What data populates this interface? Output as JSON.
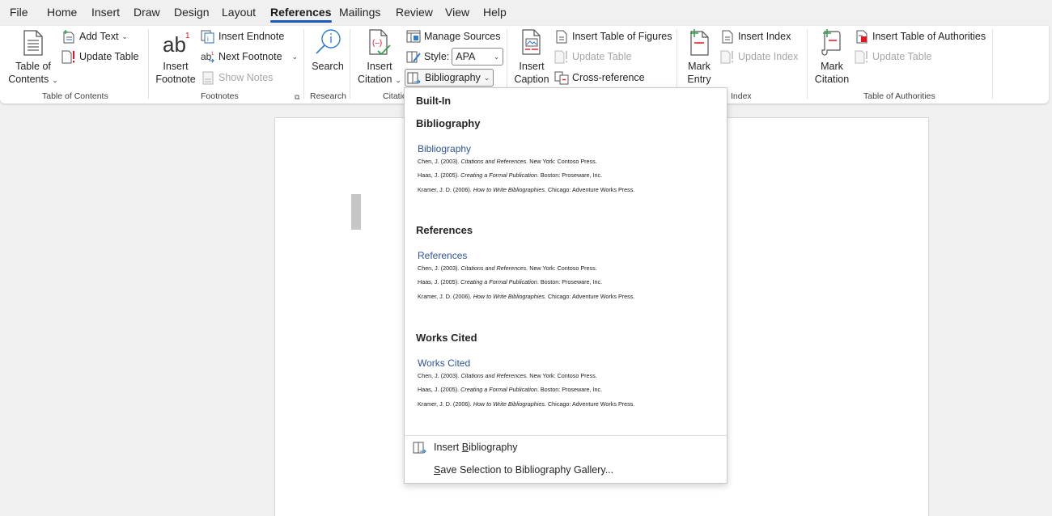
{
  "menu_tabs": [
    {
      "label": "File"
    },
    {
      "label": "Home"
    },
    {
      "label": "Insert"
    },
    {
      "label": "Draw"
    },
    {
      "label": "Design"
    },
    {
      "label": "Layout"
    },
    {
      "label": "References",
      "active": true
    },
    {
      "label": "Mailings"
    },
    {
      "label": "Review"
    },
    {
      "label": "View"
    },
    {
      "label": "Help"
    }
  ],
  "ribbon": {
    "toc": {
      "table_of_contents_line1": "Table of",
      "table_of_contents_line2": "Contents",
      "add_text": "Add Text",
      "update_table": "Update Table",
      "group_label": "Table of Contents"
    },
    "footnotes": {
      "insert_footnote_line1": "Insert",
      "insert_footnote_line2": "Footnote",
      "insert_endnote": "Insert Endnote",
      "next_footnote": "Next Footnote",
      "show_notes": "Show Notes",
      "group_label": "Footnotes"
    },
    "research": {
      "search": "Search",
      "group_label": "Research"
    },
    "citations": {
      "insert_citation_line1": "Insert",
      "insert_citation_line2": "Citation",
      "manage_sources": "Manage Sources",
      "style_label": "Style:",
      "style_value": "APA",
      "bibliography": "Bibliography",
      "group_label": "Citatio"
    },
    "captions": {
      "insert_caption_line1": "Insert",
      "insert_caption_line2": "Caption",
      "insert_table_of_figures": "Insert Table of Figures",
      "update_table": "Update Table",
      "cross_reference": "Cross-reference"
    },
    "index": {
      "mark_entry_line1": "Mark",
      "mark_entry_line2": "Entry",
      "insert_index": "Insert Index",
      "update_index": "Update Index",
      "group_label": "Index"
    },
    "authorities": {
      "mark_citation_line1": "Mark",
      "mark_citation_line2": "Citation",
      "insert_table_of_authorities": "Insert Table of Authorities",
      "update_table": "Update Table",
      "group_label": "Table of Authorities"
    }
  },
  "dropdown": {
    "header": "Built-In",
    "sections": [
      {
        "title": "Bibliography",
        "preview_heading": "Bibliography",
        "entries": [
          {
            "pre": "Chen, J. (2003). ",
            "ital": "Citations and References.",
            "post": " New York: Contoso Press."
          },
          {
            "pre": "Haas, J. (2005). ",
            "ital": "Creating a Formal Publication",
            "post": ". Boston: Proseware, Inc."
          },
          {
            "pre": "Kramer, J. D. (2006). ",
            "ital": "How to Write Bibliographies.",
            "post": " Chicago: Adventure Works Press."
          }
        ]
      },
      {
        "title": "References",
        "preview_heading": "References",
        "entries": [
          {
            "pre": "Chen, J. (2003). ",
            "ital": "Citations and References.",
            "post": " New York: Contoso Press."
          },
          {
            "pre": "Haas, J. (2005). ",
            "ital": "Creating a Formal Publication",
            "post": ". Boston: Proseware, Inc."
          },
          {
            "pre": "Kramer, J. D. (2006). ",
            "ital": "How to Write Bibliographies.",
            "post": " Chicago: Adventure Works Press."
          }
        ]
      },
      {
        "title": "Works Cited",
        "preview_heading": "Works Cited",
        "entries": [
          {
            "pre": "Chen, J. (2003). ",
            "ital": "Citations and References.",
            "post": " New York: Contoso Press."
          },
          {
            "pre": "Haas, J. (2005). ",
            "ital": "Creating a Formal Publication",
            "post": ". Boston: Proseware, Inc."
          },
          {
            "pre": "Kramer, J. D. (2006). ",
            "ital": "How to Write Bibliographies.",
            "post": " Chicago: Adventure Works Press."
          }
        ]
      }
    ],
    "insert_bibliography_pre": "Insert ",
    "insert_bibliography_accel": "B",
    "insert_bibliography_post": "ibliography",
    "save_selection_accel": "S",
    "save_selection_post": "ave Selection to Bibliography Gallery..."
  },
  "colors": {
    "accent": "#185abd",
    "preview_heading": "#2f5496",
    "disabled_text": "#a6a6a6"
  }
}
